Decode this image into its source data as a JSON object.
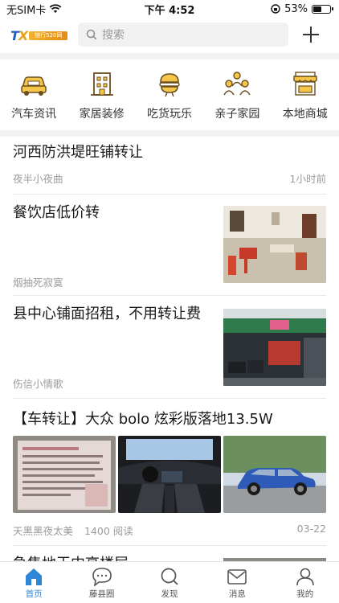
{
  "status_bar": {
    "carrier": "无SIM卡",
    "time": "下午 4:52",
    "battery": "53%",
    "battery_level": 0.53
  },
  "header": {
    "logo_text": "TX",
    "logo_tagline": "随行520网",
    "search_placeholder": "搜索"
  },
  "categories": [
    {
      "label": "汽车资讯",
      "icon": "car-icon"
    },
    {
      "label": "家居装修",
      "icon": "building-icon"
    },
    {
      "label": "吃货玩乐",
      "icon": "burger-icon"
    },
    {
      "label": "亲子家园",
      "icon": "family-icon"
    },
    {
      "label": "本地商城",
      "icon": "store-icon"
    }
  ],
  "feed": [
    {
      "title": "河西防洪堤旺铺转让",
      "author": "夜半小夜曲",
      "time": "1小时前"
    },
    {
      "title": "餐饮店低价转",
      "author": "烟抽死寂寞"
    },
    {
      "title": "县中心铺面招租，不用转让费",
      "author": "伤信小情歌"
    },
    {
      "title": "【车转让】大众 bolo 炫彩版落地13.5W",
      "author": "天黑黑夜太美",
      "views": "1400 阅读",
      "date": "03-22"
    },
    {
      "title": "急售地王中高楼层"
    }
  ],
  "tabbar": [
    {
      "label": "首页",
      "icon": "home-icon",
      "active": true
    },
    {
      "label": "藤县圈",
      "icon": "chat-bubble-icon"
    },
    {
      "label": "发现",
      "icon": "discover-icon"
    },
    {
      "label": "消息",
      "icon": "mail-icon"
    },
    {
      "label": "我的",
      "icon": "profile-icon"
    }
  ],
  "colors": {
    "accent": "#2f86d6",
    "logo_blue": "#1e5fb8",
    "logo_orange": "#e6a21a"
  }
}
